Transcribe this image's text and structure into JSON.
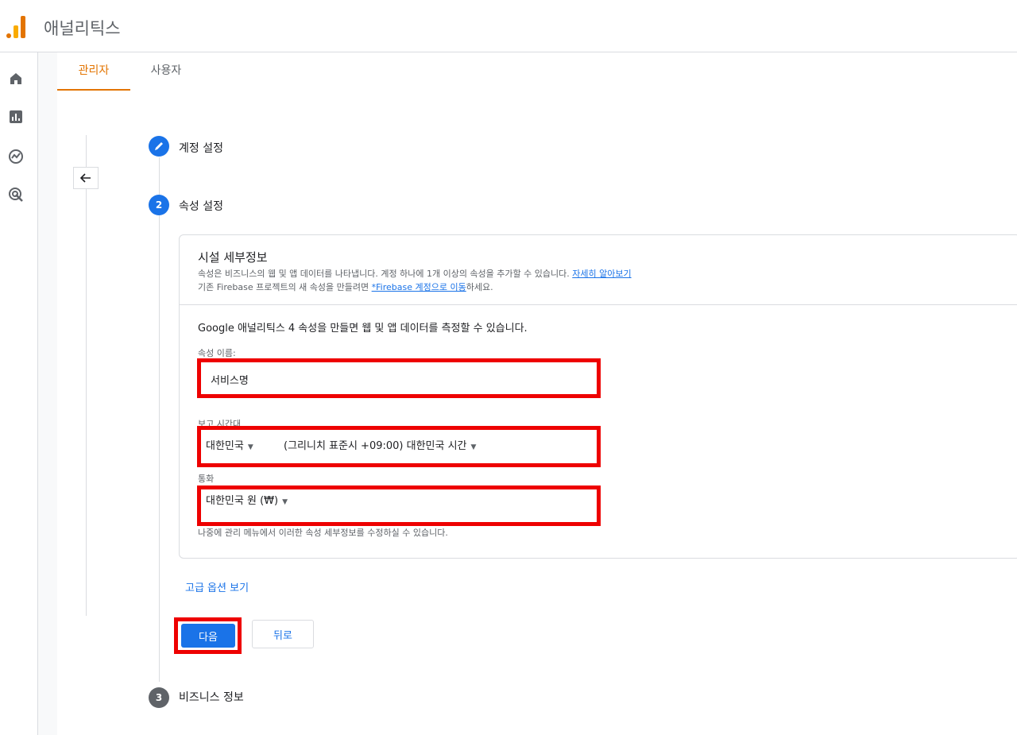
{
  "app": {
    "title": "애널리틱스"
  },
  "nav": {
    "icons": [
      "home-icon",
      "reports-icon",
      "explore-icon",
      "advertising-icon"
    ]
  },
  "tabs": [
    {
      "label": "관리자",
      "active": true
    },
    {
      "label": "사용자",
      "active": false
    }
  ],
  "steps": {
    "step1": {
      "label": "계정 설정",
      "state": "done"
    },
    "step2": {
      "number": "2",
      "label": "속성 설정",
      "state": "current"
    },
    "step3": {
      "number": "3",
      "label": "비즈니스 정보",
      "state": "pending"
    }
  },
  "card": {
    "title": "시설 세부정보",
    "desc1": "속성은 비즈니스의 웹 및 앱 데이터를 나타냅니다. 계정 하나에 1개 이상의 속성을 추가할 수 있습니다.",
    "desc1_link": "자세히 알아보기",
    "desc2_prefix": "기존 Firebase 프로젝트의 새 속성을 만들려면",
    "desc2_link": "*Firebase 계정으로 이동",
    "desc2_suffix": "하세요.",
    "intro": "Google 애널리틱스 4 속성을 만들면 웹 및 앱 데이터를 측정할 수 있습니다.",
    "property_name": {
      "label": "속성 이름",
      "value": "서비스명"
    },
    "timezone": {
      "label": "보고 시간대",
      "country": "대한민국",
      "zone": "(그리니치 표준시 +09:00) 대한민국 시간"
    },
    "currency": {
      "label": "통화",
      "value": "대한민국 원 (₩)"
    },
    "note": "나중에 관리 메뉴에서 이러한 속성 세부정보를 수정하실 수 있습니다."
  },
  "advanced_link": "고급 옵션 보기",
  "buttons": {
    "next": "다음",
    "back": "뒤로"
  },
  "colors": {
    "accent": "#e37400",
    "primary": "#1a73e8",
    "highlight": "#ee0000"
  }
}
